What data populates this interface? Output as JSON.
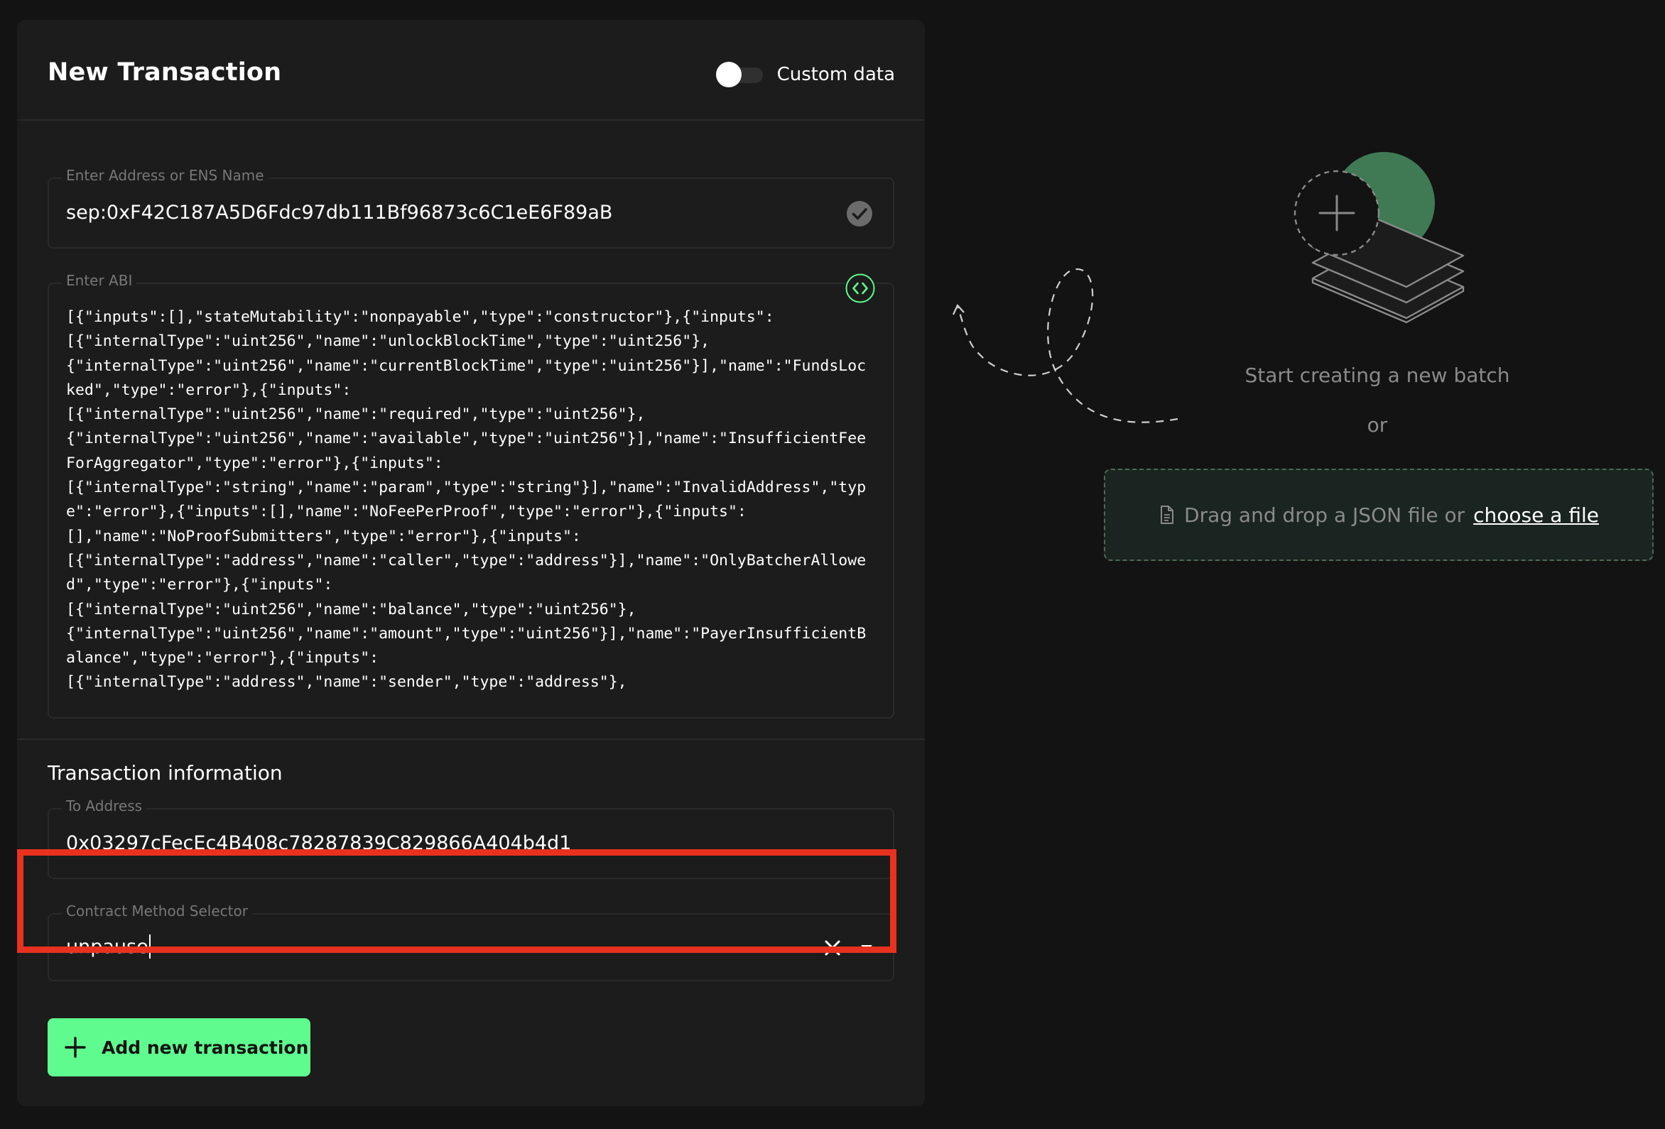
{
  "card": {
    "title": "New Transaction",
    "custom_data_label": "Custom data",
    "custom_data_enabled": false
  },
  "address_field": {
    "label": "Enter Address or ENS Name",
    "value": "sep:0xF42C187A5D6Fdc97db111Bf96873c6C1eE6F89aB"
  },
  "abi_field": {
    "label": "Enter ABI",
    "value": "[{\"inputs\":[],\"stateMutability\":\"nonpayable\",\"type\":\"constructor\"},{\"inputs\":[{\"internalType\":\"uint256\",\"name\":\"unlockBlockTime\",\"type\":\"uint256\"},{\"internalType\":\"uint256\",\"name\":\"currentBlockTime\",\"type\":\"uint256\"}],\"name\":\"FundsLocked\",\"type\":\"error\"},{\"inputs\":[{\"internalType\":\"uint256\",\"name\":\"required\",\"type\":\"uint256\"},{\"internalType\":\"uint256\",\"name\":\"available\",\"type\":\"uint256\"}],\"name\":\"InsufficientFeeForAggregator\",\"type\":\"error\"},{\"inputs\":[{\"internalType\":\"string\",\"name\":\"param\",\"type\":\"string\"}],\"name\":\"InvalidAddress\",\"type\":\"error\"},{\"inputs\":[],\"name\":\"NoFeePerProof\",\"type\":\"error\"},{\"inputs\":[],\"name\":\"NoProofSubmitters\",\"type\":\"error\"},{\"inputs\":[{\"internalType\":\"address\",\"name\":\"caller\",\"type\":\"address\"}],\"name\":\"OnlyBatcherAllowed\",\"type\":\"error\"},{\"inputs\":[{\"internalType\":\"uint256\",\"name\":\"balance\",\"type\":\"uint256\"},{\"internalType\":\"uint256\",\"name\":\"amount\",\"type\":\"uint256\"}],\"name\":\"PayerInsufficientBalance\",\"type\":\"error\"},{\"inputs\":[{\"internalType\":\"address\",\"name\":\"sender\",\"type\":\"address\"},",
    "lines": [
      "[{\"inputs\":[],\"stateMutability\":\"nonpayable\",\"type\":\"constructor\"},{\"inputs\":",
      "[{\"internalType\":\"uint256\",\"name\":\"unlockBlockTime\",\"type\":\"uint256\"},",
      "{\"internalType\":\"uint256\",\"name\":\"currentBlockTime\",\"type\":\"uint256\"}],\"name\":\"FundsLoc",
      "ked\",\"type\":\"error\"},{\"inputs\":",
      "[{\"internalType\":\"uint256\",\"name\":\"required\",\"type\":\"uint256\"},",
      "{\"internalType\":\"uint256\",\"name\":\"available\",\"type\":\"uint256\"}],\"name\":\"InsufficientFee",
      "ForAggregator\",\"type\":\"error\"},{\"inputs\":",
      "[{\"internalType\":\"string\",\"name\":\"param\",\"type\":\"string\"}],\"name\":\"InvalidAddress\",\"typ",
      "e\":\"error\"},{\"inputs\":[],\"name\":\"NoFeePerProof\",\"type\":\"error\"},{\"inputs\":",
      "[],\"name\":\"NoProofSubmitters\",\"type\":\"error\"},{\"inputs\":",
      "[{\"internalType\":\"address\",\"name\":\"caller\",\"type\":\"address\"}],\"name\":\"OnlyBatcherAllowe",
      "d\",\"type\":\"error\"},{\"inputs\":",
      "[{\"internalType\":\"uint256\",\"name\":\"balance\",\"type\":\"uint256\"},",
      "{\"internalType\":\"uint256\",\"name\":\"amount\",\"type\":\"uint256\"}],\"name\":\"PayerInsufficientB",
      "alance\",\"type\":\"error\"},{\"inputs\":",
      "[{\"internalType\":\"address\",\"name\":\"sender\",\"type\":\"address\"},"
    ]
  },
  "transaction_info": {
    "title": "Transaction information",
    "to_address_label": "To Address",
    "to_address_value": "0x03297cFecEc4B408c78287839C829866A404b4d1",
    "method_label": "Contract Method Selector",
    "method_value": "unpause"
  },
  "add_button": {
    "label": "Add new transaction"
  },
  "empty_state": {
    "title": "Start creating a new batch",
    "or": "or",
    "dropzone_text": "Drag and drop a JSON file or",
    "dropzone_link": "choose a file"
  },
  "icons": {
    "address_valid": "check-circle-icon",
    "abi_toggle": "code-icon",
    "clear": "close-icon",
    "dropdown": "chevron-down-icon",
    "add": "plus-icon",
    "file": "file-icon"
  },
  "colors": {
    "background": "#121312",
    "card": "#1c1c1c",
    "accent_green": "#5ffb8e",
    "highlight_red": "#e8321f",
    "muted_text": "#8a8a8a"
  }
}
